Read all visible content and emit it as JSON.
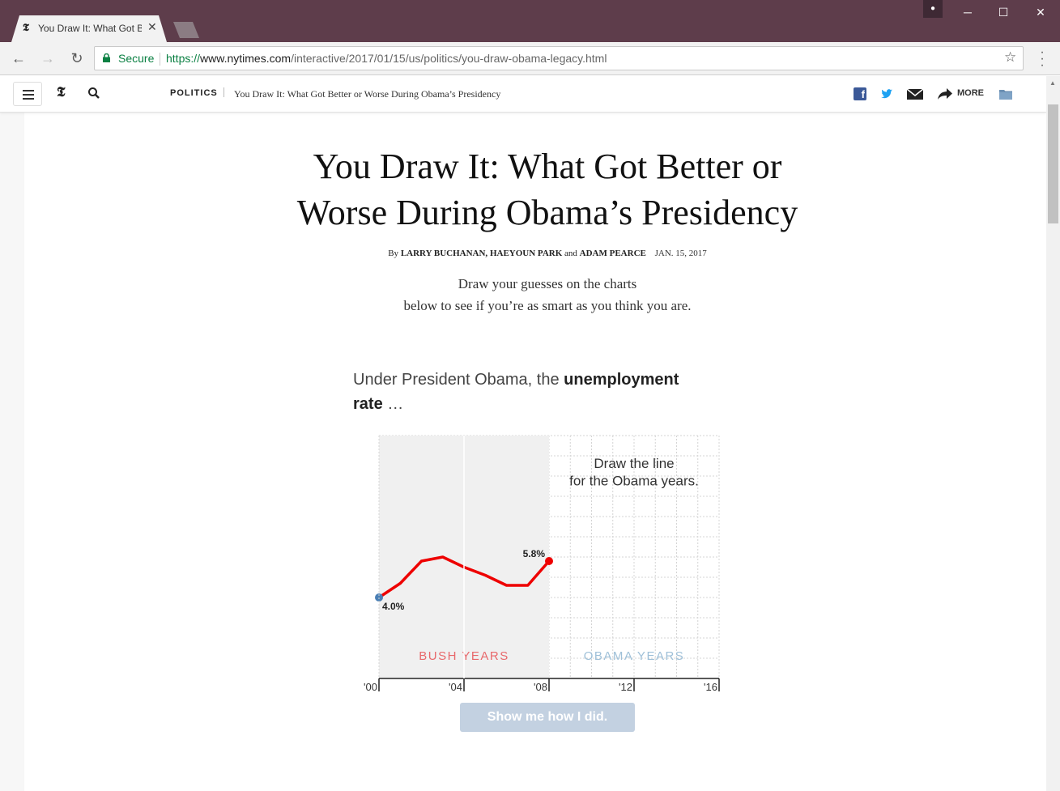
{
  "browser": {
    "tab_title": "You Draw It: What Got B",
    "tab_favicon": "𝕿",
    "secure_label": "Secure",
    "url_scheme": "https://",
    "url_host": "www.nytimes.com",
    "url_path": "/interactive/2017/01/15/us/politics/you-draw-obama-legacy.html"
  },
  "site_header": {
    "section": "POLITICS",
    "title": "You Draw It: What Got Better or Worse During Obama’s Presidency",
    "more_label": "MORE",
    "logo": "𝕿"
  },
  "article": {
    "headline_line1": "You Draw It: What Got Better or",
    "headline_line2": "Worse During Obama’s Presidency",
    "byline_prefix": "By",
    "author1": "LARRY BUCHANAN,",
    "author2": "HAEYOUN PARK",
    "byline_and": "and",
    "author3": "ADAM PEARCE",
    "date": "JAN. 15, 2017",
    "intro_line1": "Draw your guesses on the charts",
    "intro_line2": "below to see if you’re as smart as you think you are.",
    "question_prefix": "Under President Obama, the",
    "question_bold": "unemployment rate",
    "question_suffix": "…",
    "show_button": "Show me how I did."
  },
  "chart_data": {
    "type": "line",
    "title": "",
    "xlabel": "",
    "ylabel": "",
    "x_ticks": [
      "'00",
      "'04",
      "'08",
      "'12",
      "'16"
    ],
    "xlim": [
      2000,
      2016
    ],
    "ylim": [
      0,
      12
    ],
    "series": [
      {
        "name": "",
        "color": "#ee0000",
        "x": [
          2000,
          2001,
          2002,
          2003,
          2004,
          2005,
          2006,
          2007,
          2008
        ],
        "values": [
          4.0,
          4.7,
          5.8,
          6.0,
          5.5,
          5.1,
          4.6,
          4.6,
          5.8
        ]
      }
    ],
    "start_label": "4.0%",
    "end_label": "5.8%",
    "region_labels": [
      "BUSH YEARS",
      "OBAMA YEARS"
    ],
    "instruction_line1": "Draw the line",
    "instruction_line2": "for the Obama years.",
    "colors": {
      "bush": "#e8686b",
      "obama": "#9fc0d8",
      "start_point": "#4a7fb5",
      "line": "#ee0000"
    }
  }
}
